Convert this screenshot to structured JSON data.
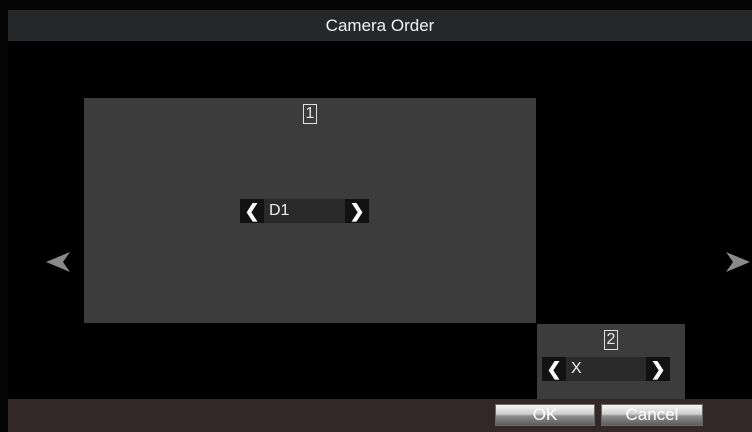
{
  "window": {
    "title": "Camera Order"
  },
  "screens": [
    {
      "number": "1",
      "camera": "D1"
    },
    {
      "number": "2",
      "camera": "X"
    }
  ],
  "icons": {
    "prev": "chevron-left-icon",
    "next": "chevron-right-icon",
    "page_prev": "triangle-left-icon",
    "page_next": "triangle-right-icon"
  },
  "buttons": {
    "ok": "OK",
    "cancel": "Cancel"
  },
  "colors": {
    "title_bar": "#252728",
    "screen_tile": "#3c3c3c",
    "footer": "#342727"
  }
}
